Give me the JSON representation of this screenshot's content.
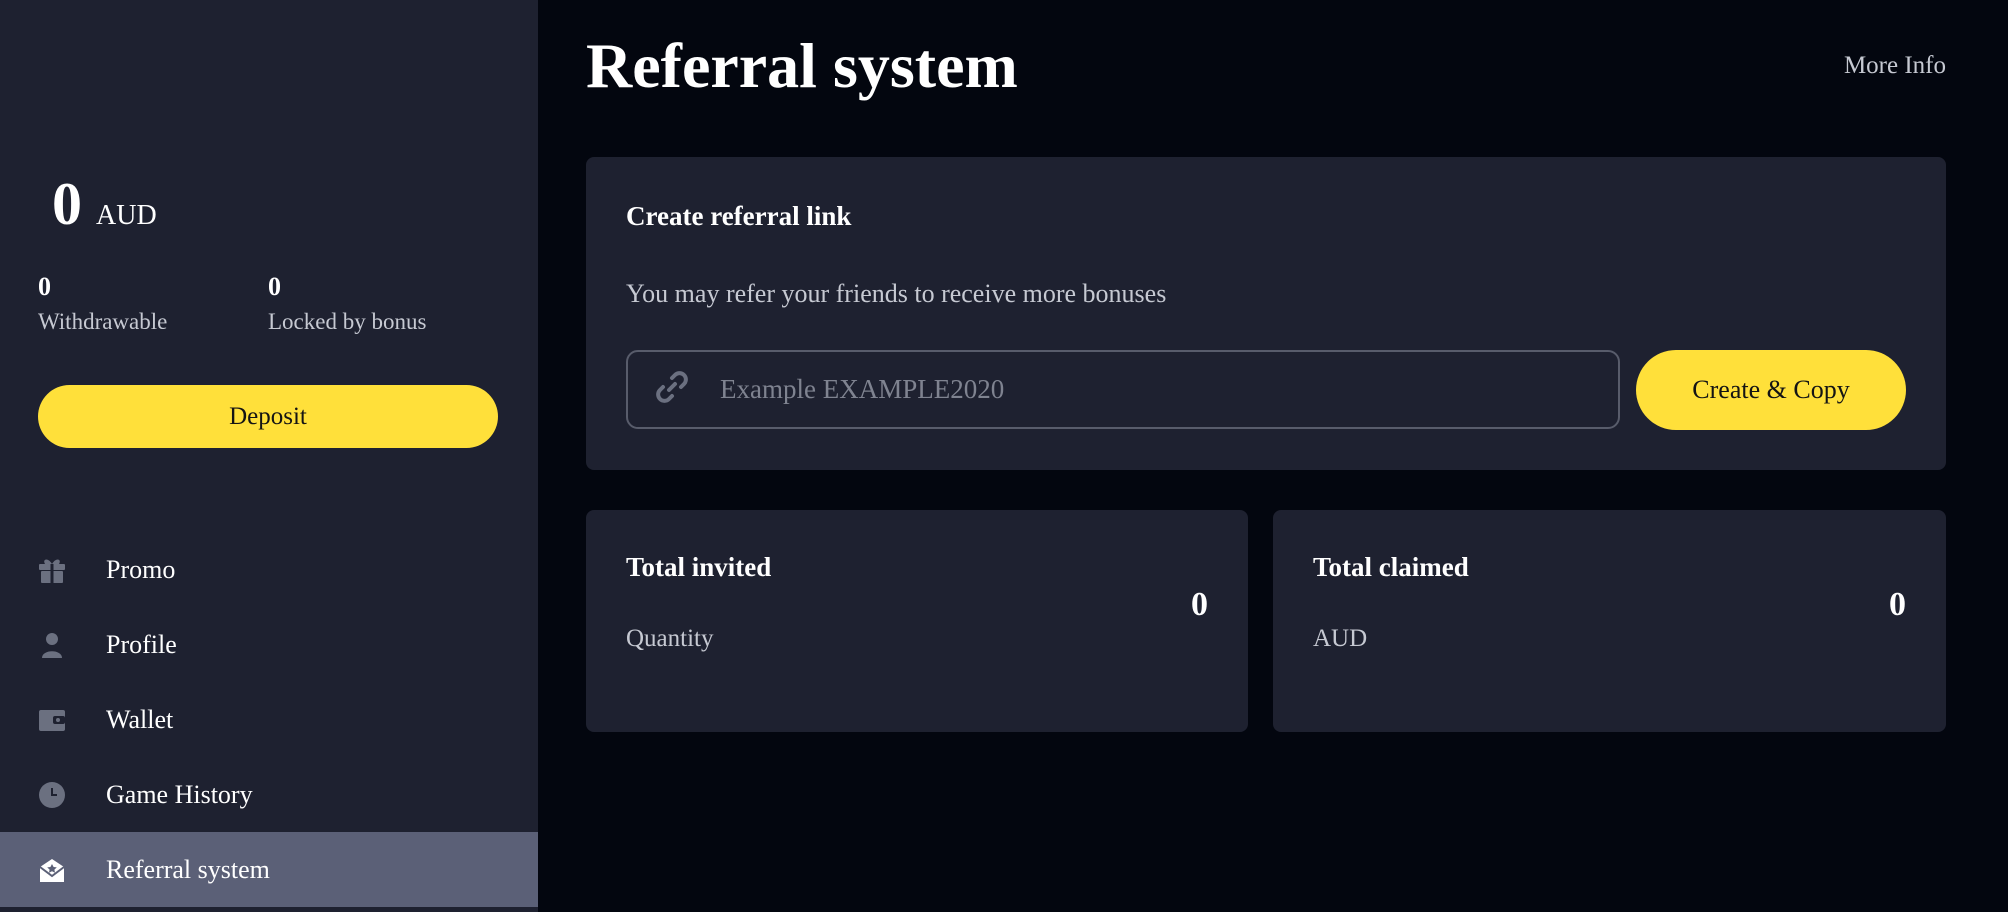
{
  "sidebar": {
    "balance": {
      "amount": "0",
      "currency": "AUD"
    },
    "withdrawable": {
      "value": "0",
      "label": "Withdrawable"
    },
    "locked": {
      "value": "0",
      "label": "Locked by bonus"
    },
    "deposit_label": "Deposit",
    "items": [
      {
        "label": "Promo",
        "icon": "gift-icon"
      },
      {
        "label": "Profile",
        "icon": "user-icon"
      },
      {
        "label": "Wallet",
        "icon": "wallet-icon"
      },
      {
        "label": "Game History",
        "icon": "clock-icon"
      },
      {
        "label": "Referral system",
        "icon": "envelope-icon",
        "active": true
      }
    ]
  },
  "header": {
    "title": "Referral system",
    "more_info": "More Info"
  },
  "referral": {
    "title": "Create referral link",
    "description": "You may refer your friends to receive more bonuses",
    "placeholder": "Example EXAMPLE2020",
    "button_label": "Create & Copy"
  },
  "stats": {
    "invited": {
      "title": "Total invited",
      "value": "0",
      "label": "Quantity"
    },
    "claimed": {
      "title": "Total claimed",
      "value": "0",
      "label": "AUD"
    }
  },
  "colors": {
    "accent": "#ffe03a",
    "sidebar_bg": "#1e2130",
    "page_bg": "#03060f",
    "active_item": "#5b6077"
  }
}
